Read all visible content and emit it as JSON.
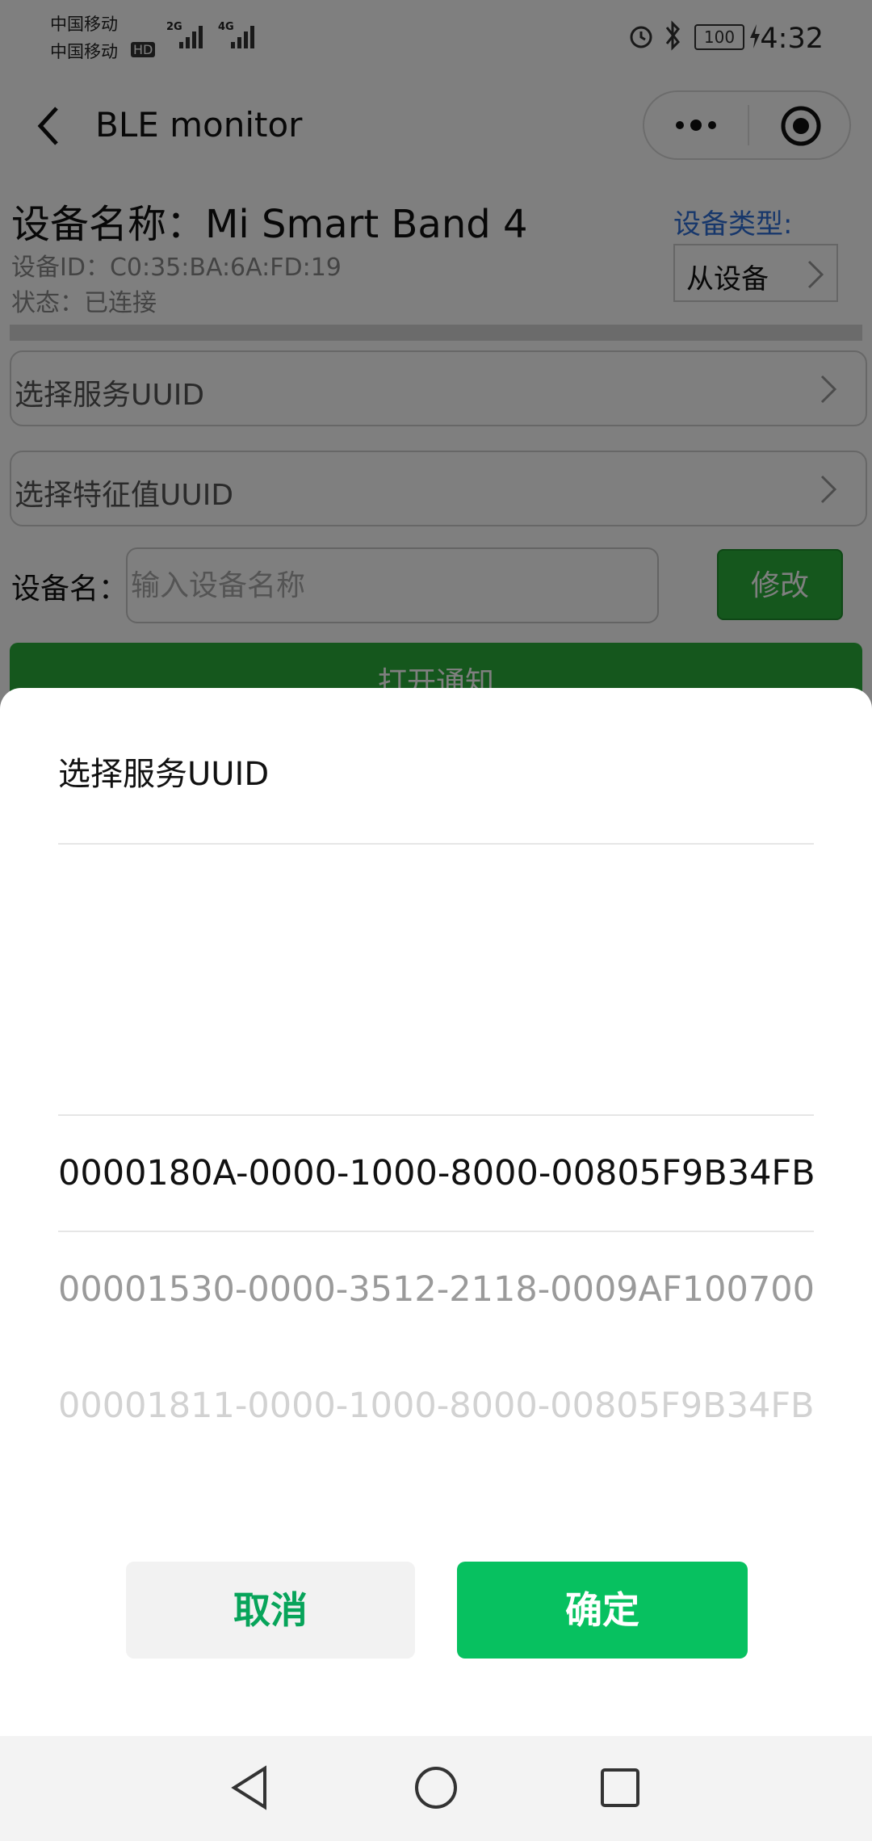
{
  "status_bar": {
    "carrier1": "中国移动",
    "carrier2": "中国移动",
    "hd": "HD",
    "net1": "2G",
    "net2": "4G",
    "battery": "100",
    "time": "4:32"
  },
  "nav": {
    "title": "BLE monitor"
  },
  "device": {
    "name_label": "设备名称：",
    "name": "Mi Smart Band 4",
    "id_label": "设备ID：",
    "id": "C0:35:BA:6A:FD:19",
    "status_label": "状态：",
    "status": "已连接",
    "type_label": "设备类型:",
    "type_value": "从设备"
  },
  "pickers": {
    "service": "选择服务UUID",
    "characteristic": "选择特征值UUID"
  },
  "rename": {
    "label": "设备名：",
    "placeholder": "输入设备名称",
    "button": "修改"
  },
  "notify_button": "打开通知",
  "sheet": {
    "title": "选择服务UUID",
    "options": [
      "0000180A-0000-1000-8000-00805F9B34FB",
      "00001530-0000-3512-2118-0009AF100700",
      "00001811-0000-1000-8000-00805F9B34FB"
    ],
    "cancel": "取消",
    "confirm": "确定"
  },
  "colors": {
    "accent_green": "#07c160",
    "button_green": "#2aae3a",
    "link_blue": "#2f6fd6"
  }
}
